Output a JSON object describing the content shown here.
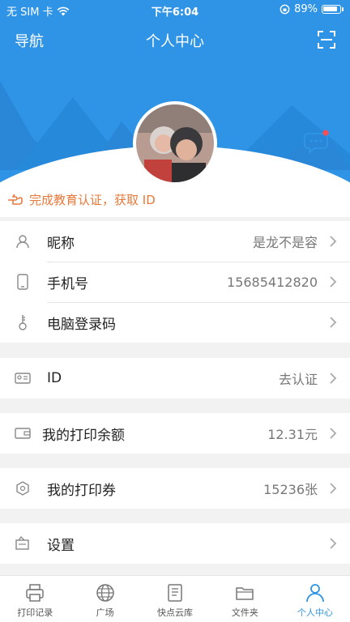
{
  "status_bar": {
    "carrier": "无 SIM 卡",
    "time": "下午6:04",
    "battery": "89%"
  },
  "nav": {
    "left": "导航",
    "title": "个人中心"
  },
  "edu_banner": "完成教育认证，获取 ID",
  "group1": [
    {
      "label": "昵称",
      "value": "是龙不是容",
      "icon": "user-icon"
    },
    {
      "label": "手机号",
      "value": "15685412820",
      "icon": "phone-icon"
    },
    {
      "label": "电脑登录码",
      "value": "",
      "icon": "key-icon"
    }
  ],
  "group2": [
    {
      "label": "ID",
      "value": "去认证",
      "icon": "id-card-icon"
    }
  ],
  "group3": [
    {
      "label": "我的打印余额",
      "value": "12.31元",
      "icon": "wallet-icon"
    }
  ],
  "group4": [
    {
      "label": "我的打印券",
      "value": "15236张",
      "icon": "coupon-icon"
    }
  ],
  "group5": [
    {
      "label": "设置",
      "value": "",
      "icon": "settings-icon"
    }
  ],
  "tabs": [
    {
      "label": "打印记录",
      "icon": "printer-icon",
      "active": false
    },
    {
      "label": "广场",
      "icon": "globe-icon",
      "active": false
    },
    {
      "label": "快点云库",
      "icon": "document-icon",
      "active": false
    },
    {
      "label": "文件夹",
      "icon": "folder-icon",
      "active": false
    },
    {
      "label": "个人中心",
      "icon": "person-icon",
      "active": true
    }
  ],
  "colors": {
    "primary": "#2f94e6",
    "accent": "#e8793a",
    "badge": "#ff4d4f"
  }
}
